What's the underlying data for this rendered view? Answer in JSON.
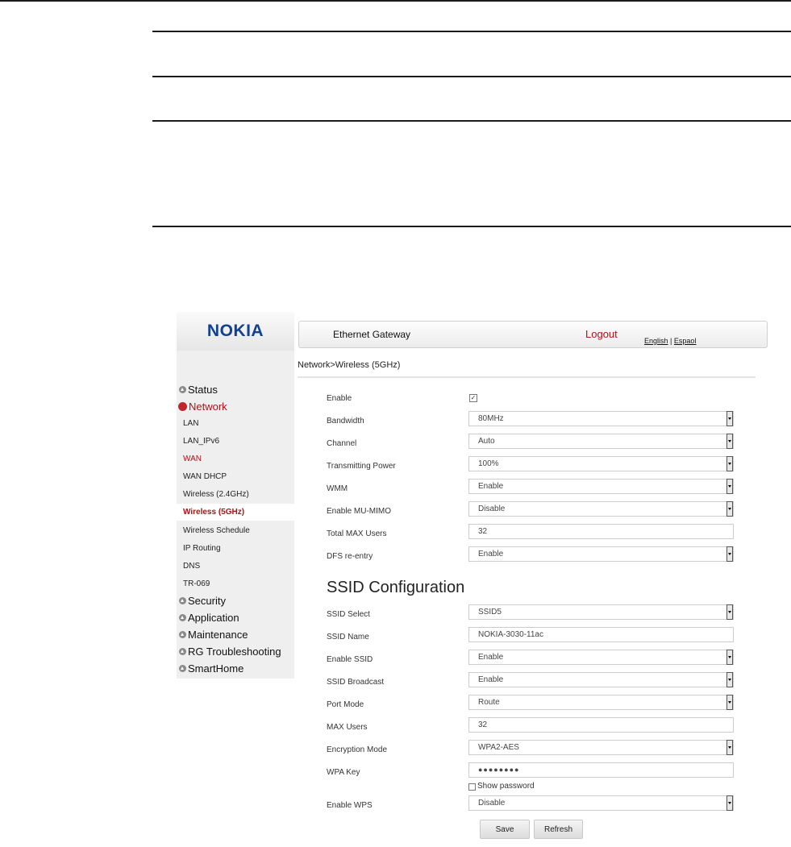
{
  "header": {
    "logo": "NOKIA",
    "app_title": "Ethernet Gateway",
    "logout": "Logout",
    "lang_english": "English",
    "lang_sep": "|",
    "lang_spanish": "Espaol"
  },
  "breadcrumb": "Network>Wireless (5GHz)",
  "sidebar": {
    "top_items": [
      {
        "label": "Status"
      },
      {
        "label": "Network"
      },
      {
        "label": "Security"
      },
      {
        "label": "Application"
      },
      {
        "label": "Maintenance"
      },
      {
        "label": "RG Troubleshooting"
      },
      {
        "label": "SmartHome"
      }
    ],
    "network_sub": [
      {
        "label": "LAN"
      },
      {
        "label": "LAN_IPv6"
      },
      {
        "label": "WAN"
      },
      {
        "label": "WAN DHCP"
      },
      {
        "label": "Wireless (2.4GHz)"
      },
      {
        "label": "Wireless (5GHz)"
      },
      {
        "label": "Wireless Schedule"
      },
      {
        "label": "IP Routing"
      },
      {
        "label": "DNS"
      },
      {
        "label": "TR-069"
      }
    ]
  },
  "wireless": {
    "enable_label": "Enable",
    "enable_checked": true,
    "enable_check_glyph": "✓",
    "fields": [
      {
        "label": "Bandwidth",
        "value": "80MHz"
      },
      {
        "label": "Channel",
        "value": "Auto"
      },
      {
        "label": "Transmitting Power",
        "value": "100%"
      },
      {
        "label": "WMM",
        "value": "Enable"
      },
      {
        "label": "Enable MU-MIMO",
        "value": "Disable"
      },
      {
        "label": "Total MAX Users",
        "value": "32"
      },
      {
        "label": "DFS re-entry",
        "value": "Enable"
      }
    ]
  },
  "ssid": {
    "heading": "SSID Configuration",
    "fields": [
      {
        "label": "SSID Select",
        "value": "SSID5"
      },
      {
        "label": "SSID Name",
        "value": "NOKIA-3030-11ac"
      },
      {
        "label": "Enable SSID",
        "value": "Enable"
      },
      {
        "label": "SSID Broadcast",
        "value": "Enable"
      },
      {
        "label": "Port Mode",
        "value": "Route"
      },
      {
        "label": "MAX Users",
        "value": "32"
      },
      {
        "label": "Encryption Mode",
        "value": "WPA2-AES"
      },
      {
        "label": "WPA Key",
        "value": "●●●●●●●●"
      },
      {
        "label": "Enable WPS",
        "value": "Disable"
      }
    ],
    "show_password_label": "Show password",
    "show_password_checked": false
  },
  "buttons": {
    "save": "Save",
    "refresh": "Refresh"
  },
  "colors": {
    "accent_red": "#a3161a",
    "nokia_blue": "#124191"
  }
}
